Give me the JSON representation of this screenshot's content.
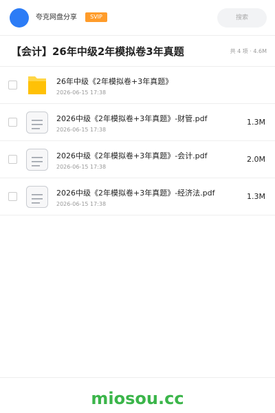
{
  "header": {
    "share_name": "夸克网盘分享",
    "badge": "SVIP",
    "search_placeholder": "搜索",
    "accent_color": "#2c7cf6",
    "badge_color": "#ff9c2a"
  },
  "folder": {
    "title": "【会计】26年中级2年模拟卷3年真题",
    "summary": "共 4 项 · 4.6M"
  },
  "files": [
    {
      "name": "26年中级《2年模拟卷+3年真题》",
      "date": "2026-06-15 17:38",
      "size": "",
      "icon": "folder-icon"
    },
    {
      "name": "2026中级《2年模拟卷+3年真题》-财管.pdf",
      "date": "2026-06-15 17:38",
      "size": "1.3M",
      "icon": "document-icon"
    },
    {
      "name": "2026中级《2年模拟卷+3年真题》-会计.pdf",
      "date": "2026-06-15 17:38",
      "size": "2.0M",
      "icon": "document-icon"
    },
    {
      "name": "2026中级《2年模拟卷+3年真题》-经济法.pdf",
      "date": "2026-06-15 17:38",
      "size": "1.3M",
      "icon": "document-icon"
    }
  ],
  "footer": {
    "watermark": "miosou.cc",
    "watermark_color": "#3bb54a"
  }
}
